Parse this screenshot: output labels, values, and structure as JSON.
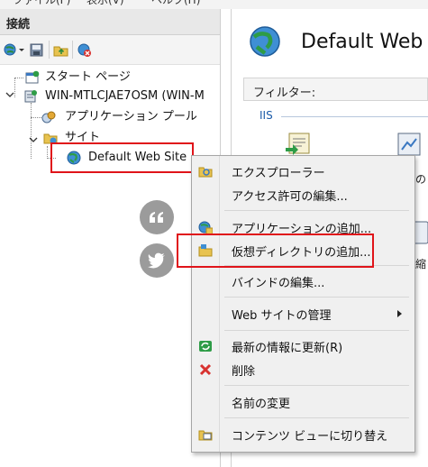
{
  "menubar": {
    "items": [
      "ファイル(F)",
      "表示(V)",
      "ヘルプ(H)"
    ]
  },
  "connections": {
    "header": "接続"
  },
  "tree": {
    "start_page": "スタート ページ",
    "server": "WIN-MTLCJAE7OSM (WIN-M",
    "app_pools": "アプリケーション プール",
    "sites": "サイト",
    "default_site": "Default Web Site"
  },
  "right": {
    "title": "Default Web S",
    "filter_label": "フィルター:",
    "group_label": "IIS",
    "partial_1": "の",
    "partial_2": "縮"
  },
  "context_menu": {
    "items": [
      {
        "label": "エクスプローラー",
        "icon": "explorer-icon"
      },
      {
        "label": "アクセス許可の編集..."
      },
      {
        "label": "アプリケーションの追加...",
        "icon": "add-application-icon"
      },
      {
        "label": "仮想ディレクトリの追加...",
        "icon": "add-virtual-directory-icon"
      },
      {
        "label": "バインドの編集..."
      },
      {
        "label": "Web サイトの管理"
      },
      {
        "label": "最新の情報に更新(R)",
        "icon": "refresh-icon"
      },
      {
        "label": "削除",
        "icon": "delete-icon"
      },
      {
        "label": "名前の変更"
      },
      {
        "label": "コンテンツ ビューに切り替え",
        "icon": "content-view-icon"
      }
    ]
  },
  "colors": {
    "highlight": "#e0141a",
    "social": "#9b9b9b",
    "accent": "#1a5aa8"
  }
}
